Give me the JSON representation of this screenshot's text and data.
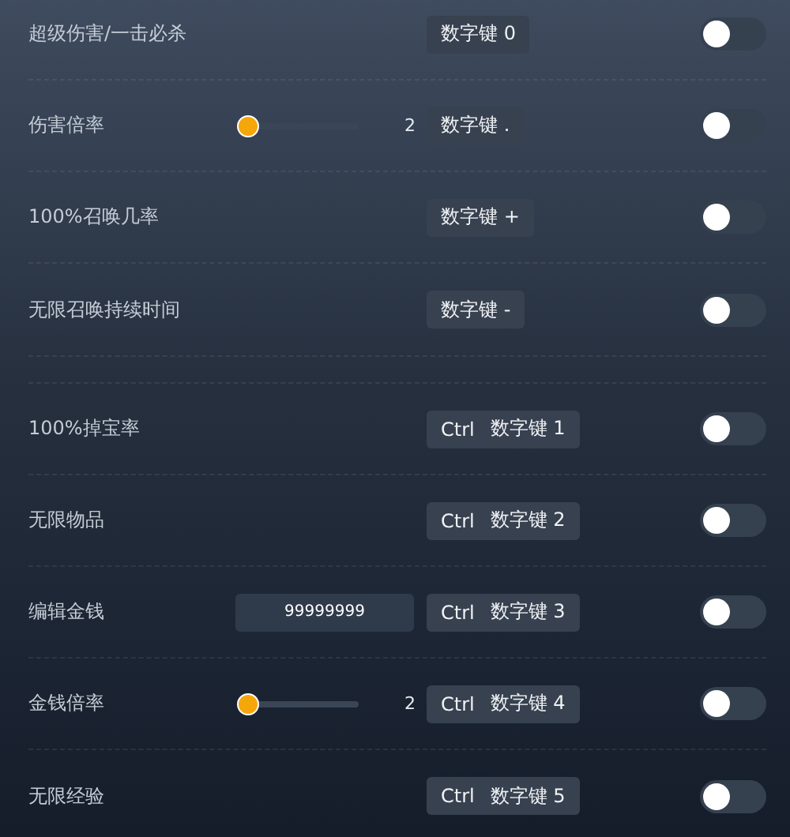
{
  "groups": [
    {
      "rows": [
        {
          "label": "超级伤害/一击必杀",
          "kind": "toggle",
          "keys": [
            "数字键 0"
          ],
          "on": false
        },
        {
          "label": "伤害倍率",
          "kind": "slider",
          "level": 0,
          "reading": "2",
          "keys": [
            "数字键 ."
          ],
          "on": false
        },
        {
          "label": "100%召唤几率",
          "kind": "toggle",
          "keys": [
            "数字键 +"
          ],
          "on": false
        },
        {
          "label": "无限召唤持续时间",
          "kind": "toggle",
          "keys": [
            "数字键 -"
          ],
          "on": false
        }
      ]
    },
    {
      "rows": [
        {
          "label": "100%掉宝率",
          "kind": "toggle",
          "keys": [
            "Ctrl",
            "数字键 1"
          ],
          "on": false
        },
        {
          "label": "无限物品",
          "kind": "toggle",
          "keys": [
            "Ctrl",
            "数字键 2"
          ],
          "on": false
        },
        {
          "label": "编辑金钱",
          "kind": "input",
          "value": "99999999",
          "keys": [
            "Ctrl",
            "数字键 3"
          ],
          "on": false
        },
        {
          "label": "金钱倍率",
          "kind": "slider",
          "level": 0,
          "reading": "2",
          "keys": [
            "Ctrl",
            "数字键 4"
          ],
          "on": false
        },
        {
          "label": "无限经验",
          "kind": "toggle",
          "keys": [
            "Ctrl",
            "数字键 5"
          ],
          "on": false
        }
      ]
    }
  ]
}
